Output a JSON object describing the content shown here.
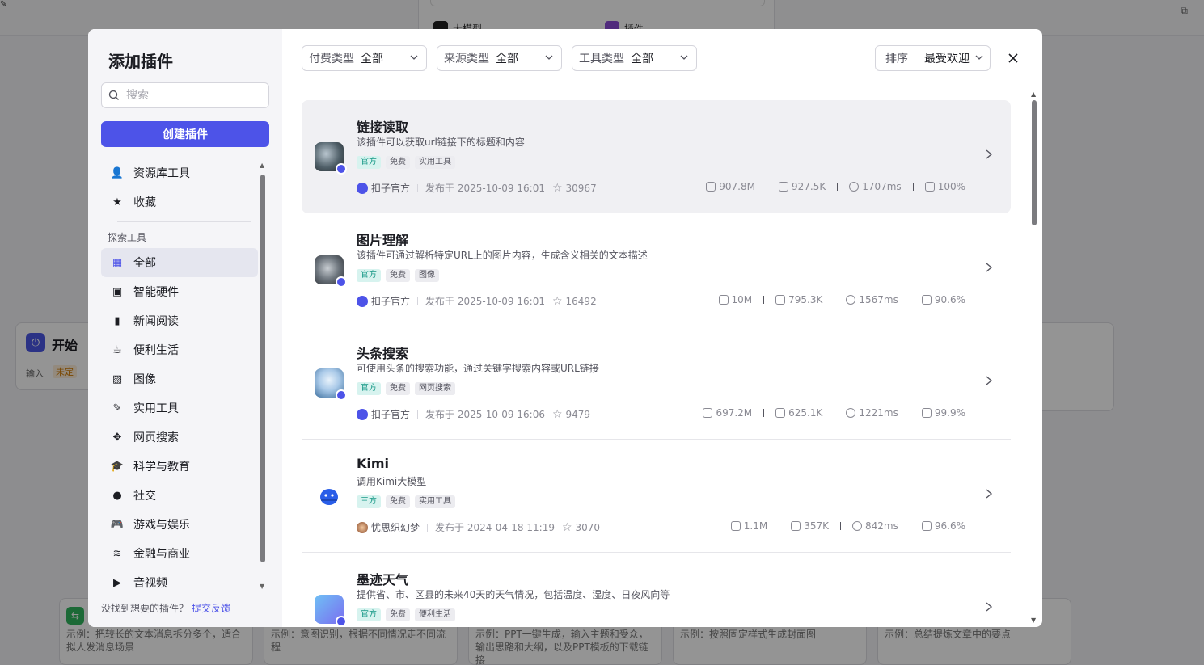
{
  "background": {
    "tabs": [
      "大模型",
      "插件"
    ],
    "start_node": {
      "title": "开始",
      "input_label": "输入",
      "tag": "未定"
    },
    "cards": [
      "示例：把较长的文本消息拆分多个，适合拟人发消息场景",
      "示例：意图识别，根据不同情况走不同流程",
      "示例：PPT一键生成，输入主题和受众，输出思路和大纲，以及PPT模板的下载链接",
      "示例：按照固定样式生成封面图",
      "示例：总结提炼文章中的要点"
    ]
  },
  "modal": {
    "title": "添加插件",
    "search_placeholder": "搜索",
    "create_button": "创建插件",
    "top_items": [
      {
        "icon": "user-icon",
        "glyph": "👤",
        "label": "资源库工具"
      },
      {
        "icon": "star-icon",
        "glyph": "★",
        "label": "收藏"
      }
    ],
    "section_label": "探索工具",
    "categories": [
      {
        "icon": "grid-icon",
        "glyph": "▦",
        "label": "全部",
        "active": true
      },
      {
        "icon": "chip-icon",
        "glyph": "▣",
        "label": "智能硬件"
      },
      {
        "icon": "book-icon",
        "glyph": "▮",
        "label": "新闻阅读"
      },
      {
        "icon": "cup-icon",
        "glyph": "☕",
        "label": "便利生活"
      },
      {
        "icon": "image-icon",
        "glyph": "▨",
        "label": "图像"
      },
      {
        "icon": "wrench-icon",
        "glyph": "✎",
        "label": "实用工具"
      },
      {
        "icon": "network-icon",
        "glyph": "✥",
        "label": "网页搜索"
      },
      {
        "icon": "graduation-icon",
        "glyph": "🎓",
        "label": "科学与教育"
      },
      {
        "icon": "chat-icon",
        "glyph": "●",
        "label": "社交"
      },
      {
        "icon": "gamepad-icon",
        "glyph": "🎮",
        "label": "游戏与娱乐"
      },
      {
        "icon": "coins-icon",
        "glyph": "≋",
        "label": "金融与商业"
      },
      {
        "icon": "video-icon",
        "glyph": "▶",
        "label": "音视频"
      }
    ],
    "footer_text": "没找到想要的插件？",
    "footer_link": "提交反馈",
    "filters": [
      {
        "label": "付费类型",
        "value": "全部"
      },
      {
        "label": "来源类型",
        "value": "全部"
      },
      {
        "label": "工具类型",
        "value": "全部"
      }
    ],
    "sort": {
      "label": "排序",
      "value": "最受欢迎"
    },
    "plugins": [
      {
        "name": "链接读取",
        "desc": "该插件可以获取url链接下的标题和内容",
        "tags": [
          "官方",
          "免费",
          "实用工具"
        ],
        "author": "扣子官方",
        "published": "发布于 2025-10-09 16:01",
        "stars": "30967",
        "stats": [
          "907.8M",
          "927.5K",
          "1707ms",
          "100%"
        ]
      },
      {
        "name": "图片理解",
        "desc": "该插件可通过解析特定URL上的图片内容，生成含义相关的文本描述",
        "tags": [
          "官方",
          "免费",
          "图像"
        ],
        "author": "扣子官方",
        "published": "发布于 2025-10-09 16:01",
        "stars": "16492",
        "stats": [
          "10M",
          "795.3K",
          "1567ms",
          "90.6%"
        ]
      },
      {
        "name": "头条搜索",
        "desc": "可使用头条的搜索功能，通过关键字搜索内容或URL链接",
        "tags": [
          "官方",
          "免费",
          "网页搜索"
        ],
        "author": "扣子官方",
        "published": "发布于 2025-10-09 16:06",
        "stars": "9479",
        "stats": [
          "697.2M",
          "625.1K",
          "1221ms",
          "99.9%"
        ]
      },
      {
        "name": "Kimi",
        "desc": "调用Kimi大模型",
        "tags": [
          "三方",
          "免费",
          "实用工具"
        ],
        "author": "忧思织幻梦",
        "published": "发布于 2024-04-18 11:19",
        "stars": "3070",
        "stats": [
          "1.1M",
          "357K",
          "842ms",
          "96.6%"
        ]
      },
      {
        "name": "墨迹天气",
        "desc": "提供省、市、区县的未来40天的天气情况，包括温度、湿度、日夜风向等",
        "tags": [
          "官方",
          "免费",
          "便利生活"
        ],
        "author": "",
        "published": "",
        "stars": "",
        "stats": [
          "",
          "",
          "",
          ""
        ]
      }
    ]
  },
  "colors": {
    "primary": "#4d53e8",
    "tag_official_bg": "#d7f3ef",
    "tag_official_fg": "#1a9a88"
  }
}
